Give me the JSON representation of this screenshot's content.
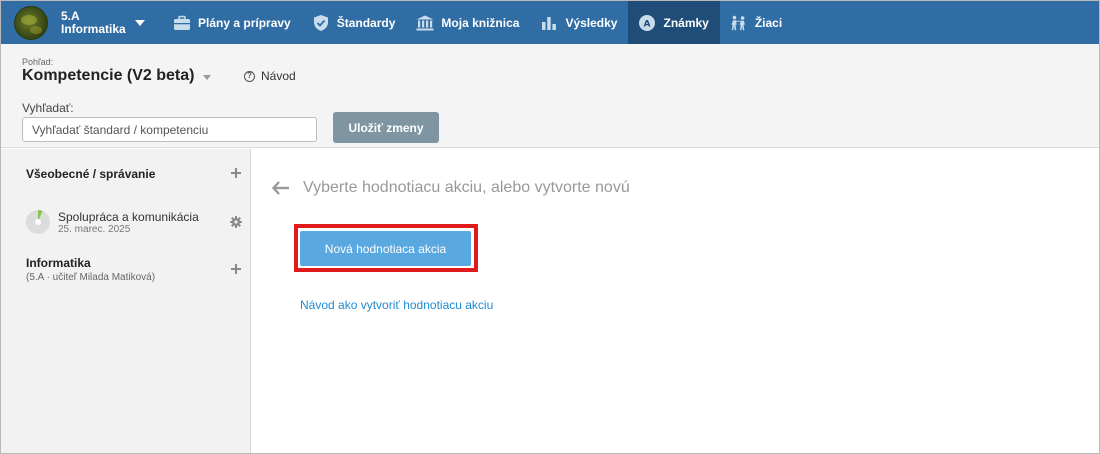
{
  "header": {
    "class_name": "5.A",
    "subject": "Informatika",
    "nav": [
      {
        "label": "Plány a prípravy",
        "icon": "briefcase-icon"
      },
      {
        "label": "Štandardy",
        "icon": "shield-check-icon"
      },
      {
        "label": "Moja knižnica",
        "icon": "library-icon"
      },
      {
        "label": "Výsledky",
        "icon": "bar-chart-icon"
      },
      {
        "label": "Známky",
        "icon": "grades-icon",
        "active": true
      },
      {
        "label": "Žiaci",
        "icon": "students-icon"
      }
    ],
    "active_color": "#1f4d77",
    "bar_color": "#2f6da4"
  },
  "toolbar": {
    "view_label": "Pohľad:",
    "view_value": "Kompetencie (V2 beta)",
    "guide_label": "Návod",
    "search_label": "Vyhľadať:",
    "search_placeholder": "Vyhľadať štandard / kompetenciu",
    "save_label": "Uložiť zmeny"
  },
  "sidebar": {
    "section_general": "Všeobecné / správanie",
    "competence": {
      "name": "Spolupráca a komunikácia",
      "date": "25. marec. 2025",
      "progress": 0.06
    },
    "subject_title": "Informatika",
    "subject_sub": "(5.A · učiteľ Milada Matiková)"
  },
  "main": {
    "title": "Vyberte hodnotiacu akciu, alebo vytvorte novú",
    "new_button": "Nová hodnotiaca akcia",
    "help_link": "Návod ako vytvoriť hodnotiacu akciu",
    "highlight_color": "#e11b1b",
    "button_color": "#5aa8e0",
    "link_color": "#1f8ad1"
  }
}
